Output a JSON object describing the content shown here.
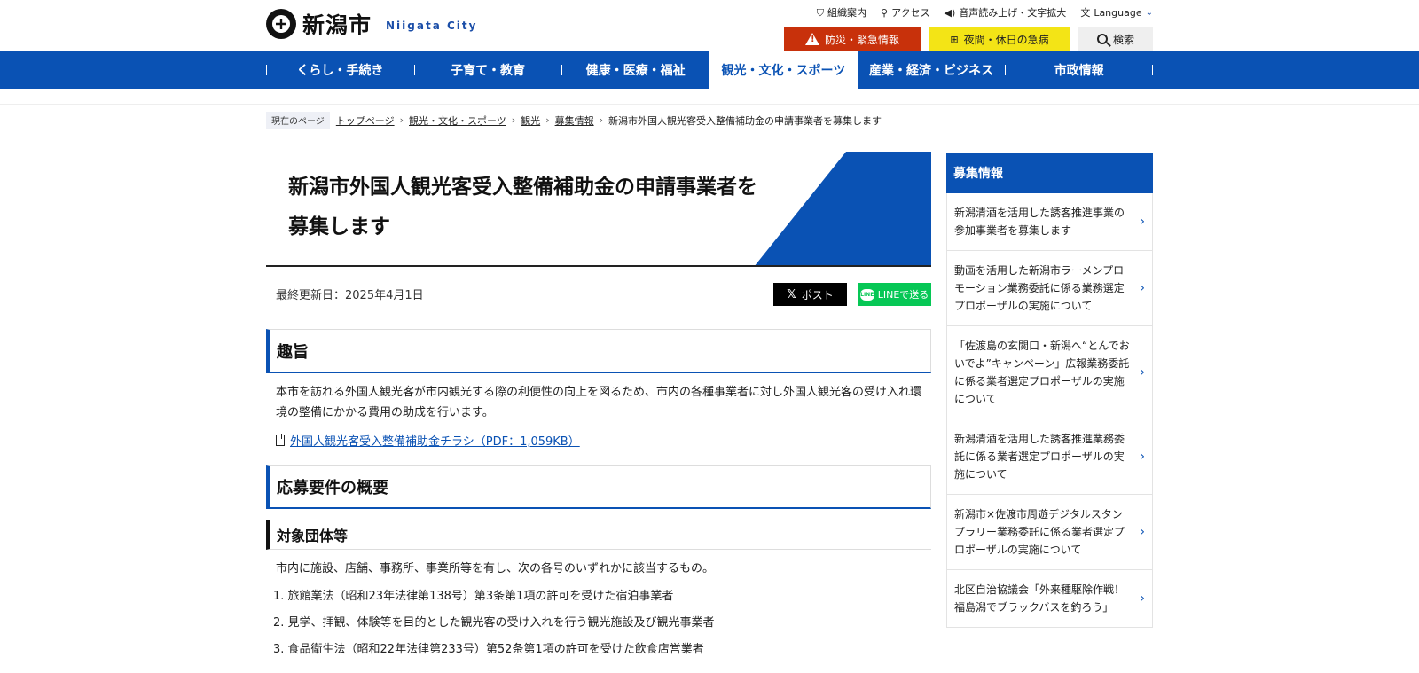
{
  "header": {
    "logo_name": "新潟市",
    "logo_sub": "Niigata City",
    "util": [
      {
        "label": "組織案内",
        "icon": "org-chart-icon"
      },
      {
        "label": "アクセス",
        "icon": "map-pin-icon"
      },
      {
        "label": "音声読み上げ・文字拡大",
        "icon": "speaker-icon"
      },
      {
        "label": "Language",
        "icon": "translate-icon"
      }
    ],
    "buttons": {
      "emergency": "防災・緊急情報",
      "night": "夜間・休日の急病",
      "search": "検索"
    }
  },
  "gnav": [
    {
      "label": "くらし・手続き"
    },
    {
      "label": "子育て・教育"
    },
    {
      "label": "健康・医療・福祉"
    },
    {
      "label": "観光・文化・スポーツ",
      "active": true
    },
    {
      "label": "産業・経済・ビジネス"
    },
    {
      "label": "市政情報"
    }
  ],
  "breadcrumb": {
    "current_label": "現在のページ",
    "items": [
      "トップページ",
      "観光・文化・スポーツ",
      "観光",
      "募集情報"
    ],
    "current": "新潟市外国人観光客受入整備補助金の申請事業者を募集します"
  },
  "page": {
    "title": "新潟市外国人観光客受入整備補助金の申請事業者を募集します",
    "updated": "最終更新日：2025年4月1日",
    "share_x": "ポスト",
    "share_line": "LINEで送る",
    "section1_title": "趣旨",
    "section1_text": "本市を訪れる外国人観光客が市内観光する際の利便性の向上を図るため、市内の各種事業者に対し外国人観光客の受け入れ環境の整備にかかる費用の助成を行います。",
    "file_link": "外国人観光客受入整備補助金チラシ（PDF：1,059KB）",
    "section2_title": "応募要件の概要",
    "section3_title": "対象団体等",
    "section3_text": "市内に施設、店舗、事務所、事業所等を有し、次の各号のいずれかに該当するもの。",
    "list": [
      "1. 旅館業法（昭和23年法律第138号）第3条第1項の許可を受けた宿泊事業者",
      "2. 見学、拝観、体験等を目的とした観光客の受け入れを行う観光施設及び観光事業者",
      "3. 食品衛生法（昭和22年法律第233号）第52条第1項の許可を受けた飲食店営業者"
    ]
  },
  "sidebar": {
    "heading": "募集情報",
    "items": [
      "新潟清酒を活用した誘客推進事業の参加事業者を募集します",
      "動画を活用した新潟市ラーメンプロモーション業務委託に係る業務選定プロポーザルの実施について",
      "「佐渡島の玄関口・新潟へ“とんでおいでよ”キャンペーン」広報業務委託に係る業者選定プロポーザルの実施について",
      "新潟清酒を活用した誘客推進業務委託に係る業者選定プロポーザルの実施について",
      "新潟市×佐渡市周遊デジタルスタンプラリー業務委託に係る業者選定プロポーザルの実施について",
      "北区自治協議会「外来種駆除作戦！福島潟でブラックバスを釣ろう」"
    ]
  },
  "colors": {
    "brand_blue": "#0a52b4",
    "emergency_red": "#c8310b",
    "night_yellow": "#f3e416",
    "line_green": "#06c755"
  }
}
